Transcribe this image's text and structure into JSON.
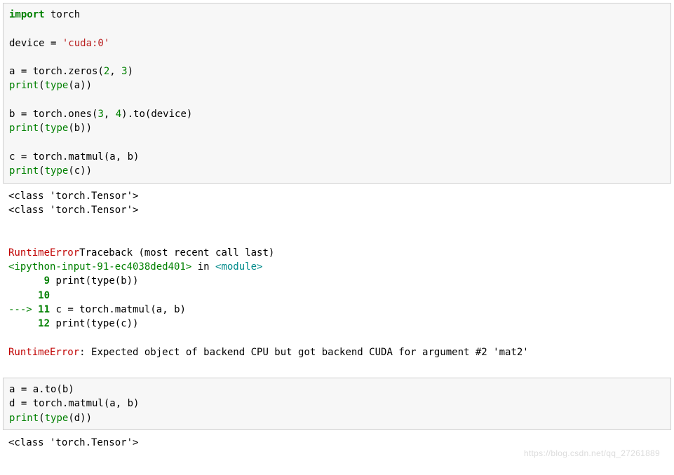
{
  "cell1": {
    "l1_kw": "import",
    "l1_rest": " torch",
    "l3_a": "device = ",
    "l3_str": "'cuda:0'",
    "l5_a": "a = torch.zeros(",
    "l5_n1": "2",
    "l5_m": ", ",
    "l5_n2": "3",
    "l5_z": ")",
    "l6_p": "print",
    "l6_a": "(",
    "l6_t": "type",
    "l6_b": "(a))",
    "l8_a": "b = torch.ones(",
    "l8_n1": "3",
    "l8_m": ", ",
    "l8_n2": "4",
    "l8_z": ").to(device)",
    "l9_p": "print",
    "l9_a": "(",
    "l9_t": "type",
    "l9_b": "(b))",
    "l11_a": "c = torch.matmul(a, b)",
    "l12_p": "print",
    "l12_a": "(",
    "l12_t": "type",
    "l12_b": "(c))"
  },
  "out1": {
    "o1": "<class 'torch.Tensor'>",
    "o2": "<class 'torch.Tensor'>",
    "tb_err1": "RuntimeError",
    "tb_text1": "Traceback (most recent call last)",
    "tb_file": "<ipython-input-91-ec4038ded401>",
    "tb_in": " in ",
    "tb_mod": "<module>",
    "ln9": "9",
    "ln9_code_a": " print",
    "ln9_code_b": "(",
    "ln9_code_c": "type",
    "ln9_code_d": "(",
    "ln9_code_e": "b",
    "ln9_code_f": "))",
    "ln10": "10",
    "arrow": "---> ",
    "ln11": "11",
    "ln11_code_a": " c ",
    "ln11_code_b": "=",
    "ln11_code_c": " torch",
    "ln11_code_d": ".",
    "ln11_code_e": "matmul",
    "ln11_code_f": "(",
    "ln11_code_g": "a",
    "ln11_code_h": ",",
    "ln11_code_i": " b",
    "ln11_code_j": ")",
    "ln12": "12",
    "ln12_code_a": " print",
    "ln12_code_b": "(",
    "ln12_code_c": "type",
    "ln12_code_d": "(",
    "ln12_code_e": "c",
    "ln12_code_f": "))",
    "err2": "RuntimeError",
    "err2_msg": ": Expected object of backend CPU but got backend CUDA for argument #2 'mat2'"
  },
  "cell2": {
    "l1": "a = a.to(b)",
    "l2_a": "d = torch.matmul",
    "l2_b": "(a, b)",
    "l3_p": "print",
    "l3_a": "(",
    "l3_t": "type",
    "l3_b": "(d))"
  },
  "out2": {
    "o1": "<class 'torch.Tensor'>"
  },
  "watermark": "https://blog.csdn.net/qq_27261889"
}
